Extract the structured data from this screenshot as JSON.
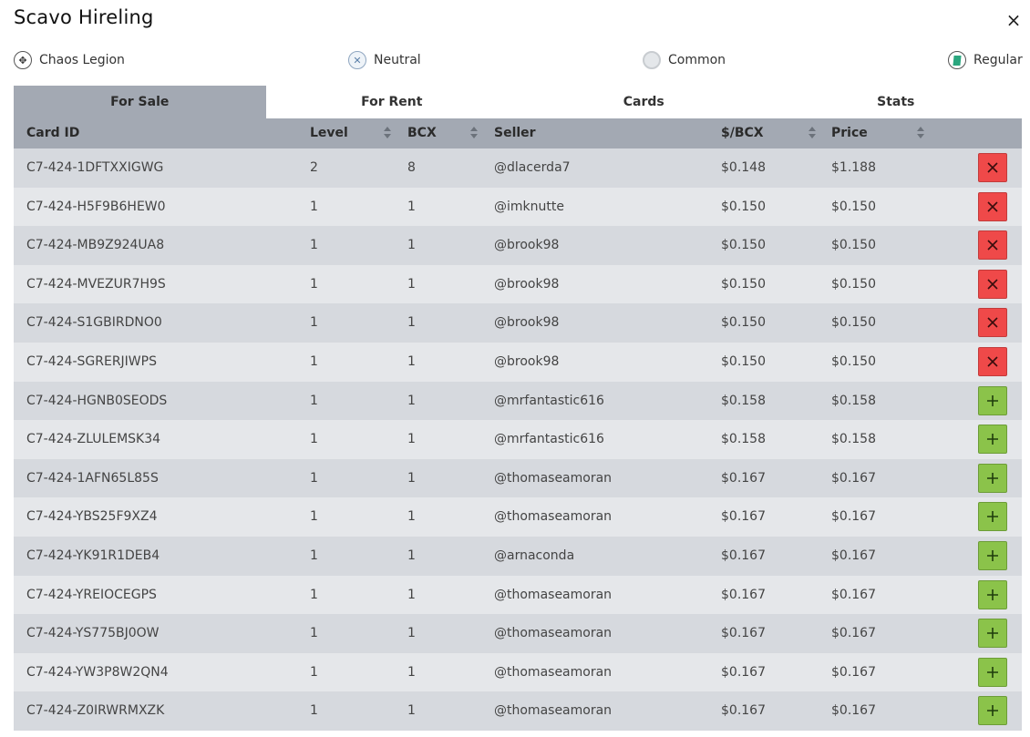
{
  "title": "Scavo Hireling",
  "close_label": "×",
  "attributes": [
    {
      "name": "Chaos Legion",
      "icon": "chaos-legion-icon"
    },
    {
      "name": "Neutral",
      "icon": "neutral-icon"
    },
    {
      "name": "Common",
      "icon": "common-rarity-icon"
    },
    {
      "name": "Regular",
      "icon": "regular-edition-icon"
    }
  ],
  "tabs": [
    {
      "label": "For Sale",
      "active": true
    },
    {
      "label": "For Rent",
      "active": false
    },
    {
      "label": "Cards",
      "active": false
    },
    {
      "label": "Stats",
      "active": false
    }
  ],
  "columns": {
    "card_id": "Card ID",
    "level": "Level",
    "bcx": "BCX",
    "seller": "Seller",
    "per_bcx": "$/BCX",
    "price": "Price"
  },
  "colors": {
    "header_bg": "#a3a9b3",
    "row_odd": "#d6d9de",
    "row_even": "#e5e7ea",
    "remove_button": "#ef4949",
    "add_button": "#8bc34a"
  },
  "rows": [
    {
      "card_id": "C7-424-1DFTXXIGWG",
      "level": "2",
      "bcx": "8",
      "seller": "@dlacerda7",
      "per_bcx": "$0.148",
      "price": "$1.188",
      "action": "remove"
    },
    {
      "card_id": "C7-424-H5F9B6HEW0",
      "level": "1",
      "bcx": "1",
      "seller": "@imknutte",
      "per_bcx": "$0.150",
      "price": "$0.150",
      "action": "remove"
    },
    {
      "card_id": "C7-424-MB9Z924UA8",
      "level": "1",
      "bcx": "1",
      "seller": "@brook98",
      "per_bcx": "$0.150",
      "price": "$0.150",
      "action": "remove"
    },
    {
      "card_id": "C7-424-MVEZUR7H9S",
      "level": "1",
      "bcx": "1",
      "seller": "@brook98",
      "per_bcx": "$0.150",
      "price": "$0.150",
      "action": "remove"
    },
    {
      "card_id": "C7-424-S1GBIRDNO0",
      "level": "1",
      "bcx": "1",
      "seller": "@brook98",
      "per_bcx": "$0.150",
      "price": "$0.150",
      "action": "remove"
    },
    {
      "card_id": "C7-424-SGRERJIWPS",
      "level": "1",
      "bcx": "1",
      "seller": "@brook98",
      "per_bcx": "$0.150",
      "price": "$0.150",
      "action": "remove"
    },
    {
      "card_id": "C7-424-HGNB0SEODS",
      "level": "1",
      "bcx": "1",
      "seller": "@mrfantastic616",
      "per_bcx": "$0.158",
      "price": "$0.158",
      "action": "add"
    },
    {
      "card_id": "C7-424-ZLULEMSK34",
      "level": "1",
      "bcx": "1",
      "seller": "@mrfantastic616",
      "per_bcx": "$0.158",
      "price": "$0.158",
      "action": "add"
    },
    {
      "card_id": "C7-424-1AFN65L85S",
      "level": "1",
      "bcx": "1",
      "seller": "@thomaseamoran",
      "per_bcx": "$0.167",
      "price": "$0.167",
      "action": "add"
    },
    {
      "card_id": "C7-424-YBS25F9XZ4",
      "level": "1",
      "bcx": "1",
      "seller": "@thomaseamoran",
      "per_bcx": "$0.167",
      "price": "$0.167",
      "action": "add"
    },
    {
      "card_id": "C7-424-YK91R1DEB4",
      "level": "1",
      "bcx": "1",
      "seller": "@arnaconda",
      "per_bcx": "$0.167",
      "price": "$0.167",
      "action": "add"
    },
    {
      "card_id": "C7-424-YREIOCEGPS",
      "level": "1",
      "bcx": "1",
      "seller": "@thomaseamoran",
      "per_bcx": "$0.167",
      "price": "$0.167",
      "action": "add"
    },
    {
      "card_id": "C7-424-YS775BJ0OW",
      "level": "1",
      "bcx": "1",
      "seller": "@thomaseamoran",
      "per_bcx": "$0.167",
      "price": "$0.167",
      "action": "add"
    },
    {
      "card_id": "C7-424-YW3P8W2QN4",
      "level": "1",
      "bcx": "1",
      "seller": "@thomaseamoran",
      "per_bcx": "$0.167",
      "price": "$0.167",
      "action": "add"
    },
    {
      "card_id": "C7-424-Z0IRWRMXZK",
      "level": "1",
      "bcx": "1",
      "seller": "@thomaseamoran",
      "per_bcx": "$0.167",
      "price": "$0.167",
      "action": "add"
    }
  ]
}
